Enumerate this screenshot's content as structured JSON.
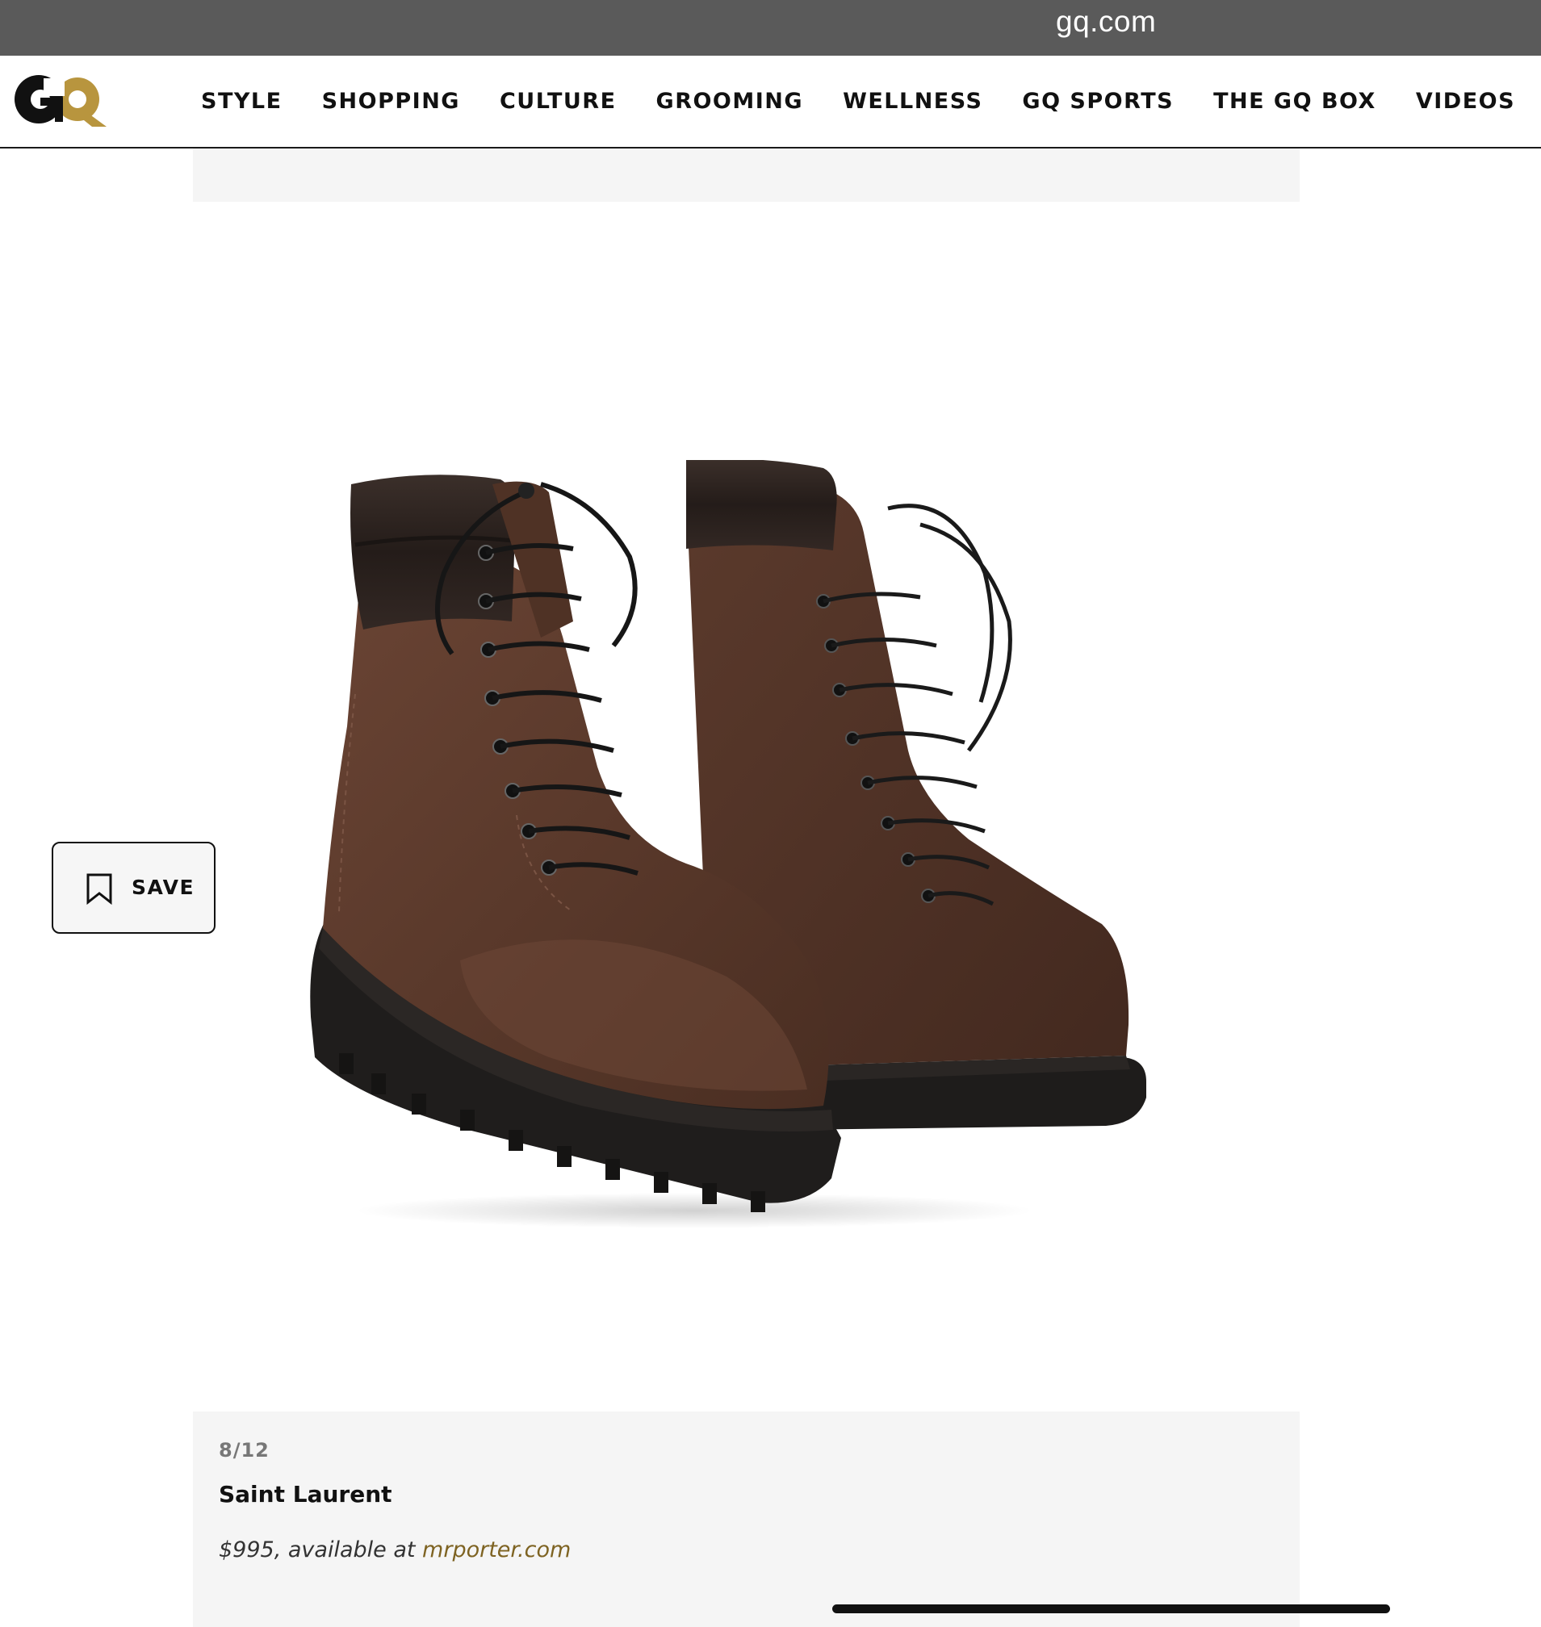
{
  "browser": {
    "url": "gq.com"
  },
  "header": {
    "logo_text": "GQ",
    "nav": [
      {
        "label": "STYLE"
      },
      {
        "label": "SHOPPING"
      },
      {
        "label": "CULTURE"
      },
      {
        "label": "GROOMING"
      },
      {
        "label": "WELLNESS"
      },
      {
        "label": "GQ SPORTS"
      },
      {
        "label": "THE GQ BOX"
      },
      {
        "label": "VIDEOS"
      }
    ]
  },
  "colors": {
    "url_bar": "#5a5a5a",
    "logo_g": "#111111",
    "logo_q": "#b8953e",
    "caption_bg": "#f5f5f5",
    "link": "#7e6322",
    "leather_suede": "#5a3a2c",
    "sole": "#1e1c1b"
  },
  "save_button": {
    "label": "SAVE",
    "icon": "bookmark-icon"
  },
  "slide": {
    "counter": "8/12",
    "title": "Saint Laurent",
    "price_text": "$995, available at ",
    "retailer_link": "mrporter.com"
  }
}
